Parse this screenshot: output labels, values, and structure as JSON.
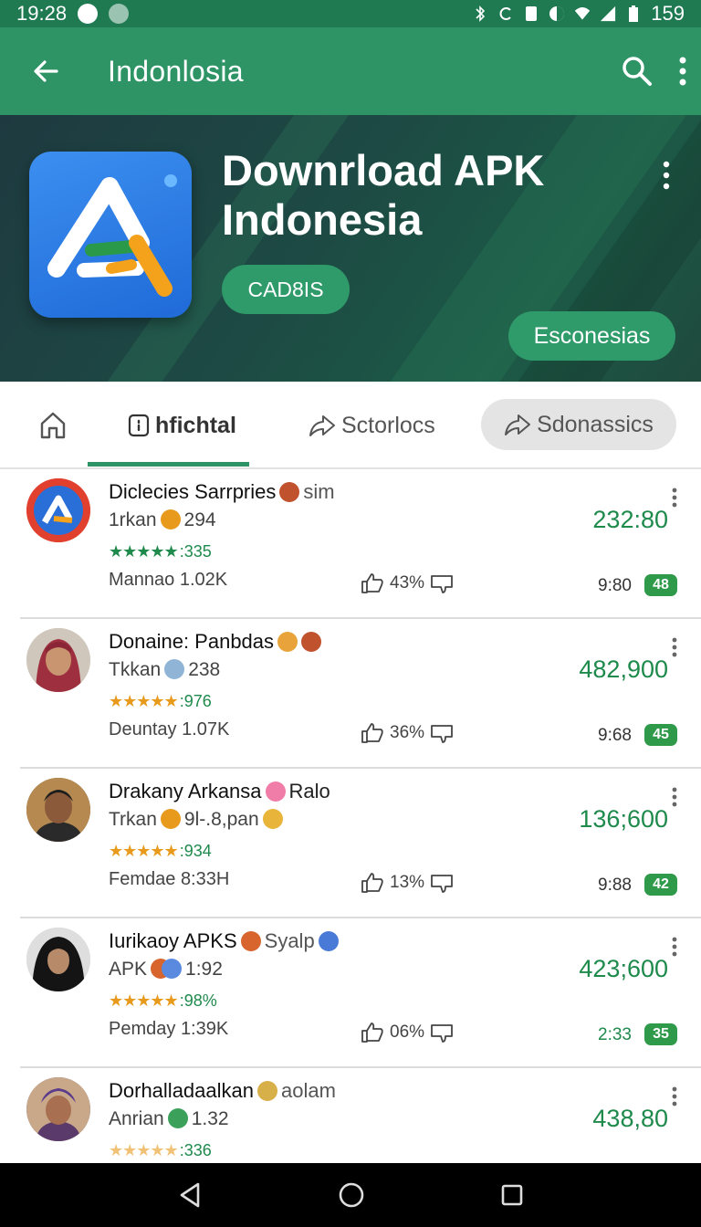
{
  "status": {
    "time": "19:28",
    "battery": "159"
  },
  "app_bar": {
    "title": "Indonlosia"
  },
  "hero": {
    "title": "Downrload APK Indonesia",
    "chip": "CAD8IS",
    "button": "Esconesias"
  },
  "tabs": [
    {
      "label": "hfichtal"
    },
    {
      "label": "Sctorlocs"
    },
    {
      "label": "Sdonassics"
    }
  ],
  "items": [
    {
      "name": "Diclecies Sarrpries",
      "tag": "sim",
      "sub_label": "1rkan",
      "sub_value": "294",
      "rating": ":335",
      "stars": "★★★★★",
      "meta_label": "Mannao",
      "meta_value": "1.02K",
      "likes": "43%",
      "price": "232:80",
      "time": "9:80",
      "badge": "48"
    },
    {
      "name": "Donaine: Panbdas",
      "tag": "",
      "sub_label": "Tkkan",
      "sub_value": "238",
      "rating": ":976",
      "stars": "★★★★★",
      "meta_label": "Deuntay",
      "meta_value": "1.07K",
      "likes": "36%",
      "price": "482,900",
      "time": "9:68",
      "badge": "45"
    },
    {
      "name": "Drakany Arkansa",
      "tag": "Ralo",
      "sub_label": "Trkan",
      "sub_value": "9l-.8,pan",
      "rating": ":934",
      "stars": "★★★★★",
      "meta_label": "Femdae",
      "meta_value": "8:33H",
      "likes": "13%",
      "price": "136;600",
      "time": "9:88",
      "badge": "42"
    },
    {
      "name": "Iurikaoy APKS",
      "tag": "Syalp",
      "sub_label": "APK",
      "sub_value": "1:92",
      "rating": ":98%",
      "stars": "★★★★★",
      "meta_label": "Pemday",
      "meta_value": "1:39K",
      "likes": "06%",
      "price": "423;600",
      "time": "2:33",
      "badge": "35"
    },
    {
      "name": "Dorhalladaalkan",
      "tag": "aolam",
      "sub_label": "Anrian",
      "sub_value": "1.32",
      "rating": ":336",
      "stars": "★★★★★",
      "meta_label": "",
      "meta_value": "",
      "likes": "",
      "price": "438,80",
      "time": "",
      "badge": ""
    }
  ],
  "colors": {
    "primary": "#2e9466",
    "primary_dark": "#1f7a52",
    "accent_green_text": "#1e8a4c",
    "star": "#e89a1c"
  },
  "icons": [
    "back-arrow-icon",
    "search-icon",
    "more-vert-icon",
    "home-icon",
    "list-icon",
    "share-icon",
    "thumb-up-icon",
    "thumb-down-icon",
    "nav-back-icon",
    "nav-home-icon",
    "nav-recents-icon"
  ]
}
